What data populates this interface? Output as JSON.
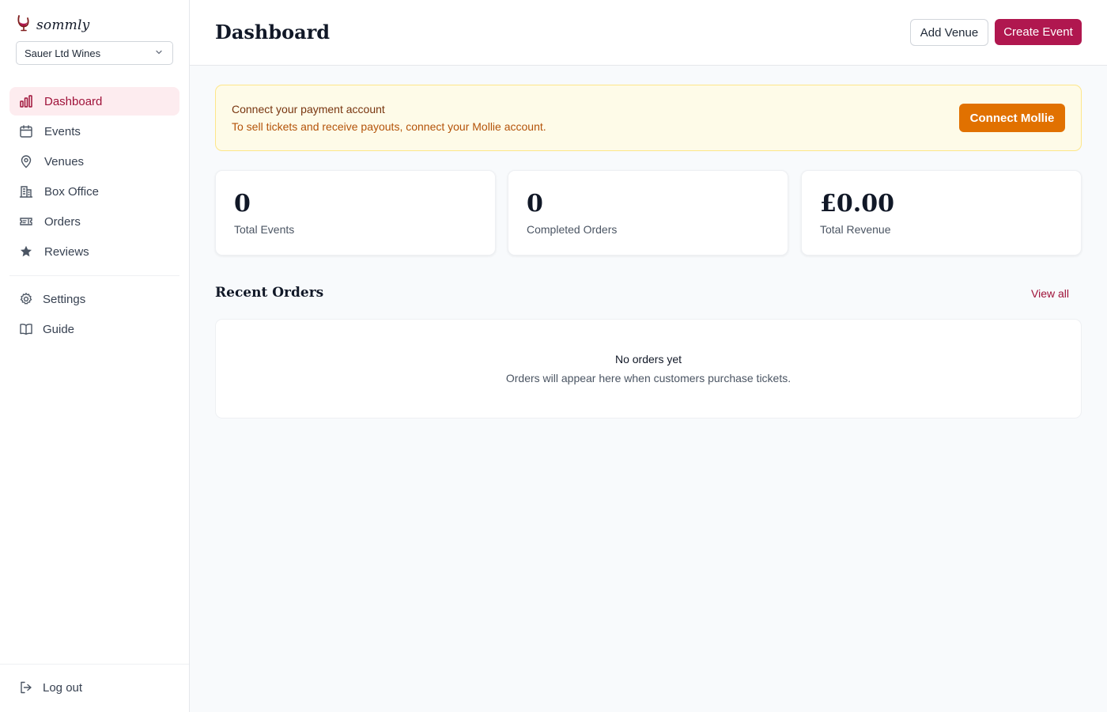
{
  "brand": {
    "name": "sommly",
    "accent": "#b0174f",
    "logo_icon": "wine-glass-icon"
  },
  "org_selector": {
    "value": "Sauer Ltd Wines",
    "icon": "chevron-down-icon"
  },
  "nav": {
    "items": [
      {
        "label": "Dashboard",
        "icon": "bar-chart-icon",
        "active": true
      },
      {
        "label": "Events",
        "icon": "calendar-icon"
      },
      {
        "label": "Venues",
        "icon": "map-pin-icon"
      },
      {
        "label": "Box Office",
        "icon": "building-icon"
      },
      {
        "label": "Orders",
        "icon": "ticket-icon"
      },
      {
        "label": "Reviews",
        "icon": "star-icon"
      }
    ],
    "secondary": [
      {
        "label": "Settings",
        "icon": "gear-icon"
      },
      {
        "label": "Guide",
        "icon": "book-open-icon"
      }
    ],
    "logout": {
      "label": "Log out",
      "icon": "log-out-icon"
    }
  },
  "header": {
    "title": "Dashboard",
    "add_venue": "Add Venue",
    "create_event": "Create Event"
  },
  "banner": {
    "title": "Connect your payment account",
    "text": "To sell tickets and receive payouts, connect your Mollie account.",
    "button": "Connect Mollie",
    "button_color": "#e17100",
    "bg_color": "#fefbe8"
  },
  "stats": [
    {
      "value": "0",
      "label": "Total Events"
    },
    {
      "value": "0",
      "label": "Completed Orders"
    },
    {
      "value": "£0.00",
      "label": "Total Revenue"
    }
  ],
  "recent_orders": {
    "title": "Recent Orders",
    "view_all": "View all",
    "empty_title": "No orders yet",
    "empty_text": "Orders will appear here when customers purchase tickets."
  }
}
